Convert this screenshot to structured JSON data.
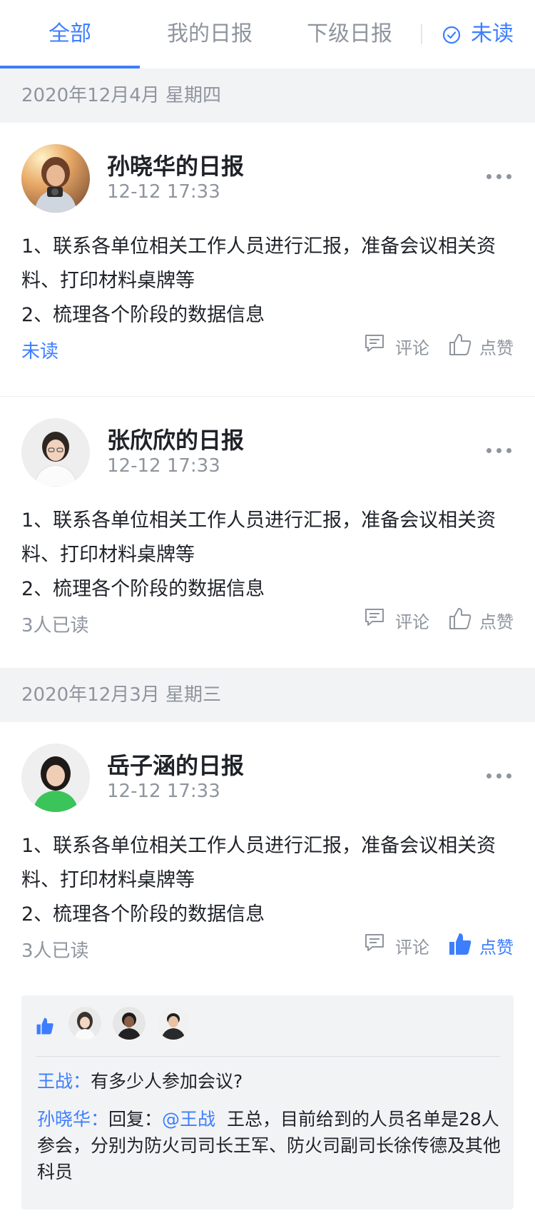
{
  "tabs": [
    {
      "label": "全部",
      "active": true
    },
    {
      "label": "我的日报",
      "active": false
    },
    {
      "label": "下级日报",
      "active": false
    }
  ],
  "unread_filter": {
    "label": "未读",
    "icon": "check-circle-icon"
  },
  "sections": [
    {
      "date": "2020年12月4月  星期四",
      "cards": [
        {
          "title": "孙晓华的日报",
          "time": "12-12 17:33",
          "lines": [
            "1、联系各单位相关工作人员进行汇报，准备会议相关资料、打印材料桌牌等",
            "2、梳理各个阶段的数据信息"
          ],
          "read_status": "未读",
          "comment_label": "评论",
          "like_label": "点赞"
        },
        {
          "title": "张欣欣的日报",
          "time": "12-12 17:33",
          "lines": [
            "1、联系各单位相关工作人员进行汇报，准备会议相关资料、打印材料桌牌等",
            "2、梳理各个阶段的数据信息"
          ],
          "read_status": "3人已读",
          "comment_label": "评论",
          "like_label": "点赞"
        }
      ]
    },
    {
      "date": "2020年12月3月  星期三",
      "cards": [
        {
          "title": "岳子涵的日报",
          "time": "12-12 17:33",
          "lines": [
            "1、联系各单位相关工作人员进行汇报，准备会议相关资料、打印材料桌牌等",
            "2、梳理各个阶段的数据信息"
          ],
          "read_status": "3人已读",
          "comment_label": "评论",
          "like_label": "点赞",
          "liked": true
        }
      ]
    }
  ],
  "comments": [
    {
      "author": "王战：",
      "text": "有多少人参加会议?"
    },
    {
      "author": "孙晓华：",
      "reply_prefix": "回复：",
      "mention": "@王战",
      "text": "王总，目前给到的人员名单是28人参会，分别为防火司司长王军、防火司副司长徐传德及其他科员"
    }
  ],
  "colors": {
    "accent": "#3d7eff",
    "muted": "#8f959e",
    "section_bg": "#f2f3f5"
  }
}
